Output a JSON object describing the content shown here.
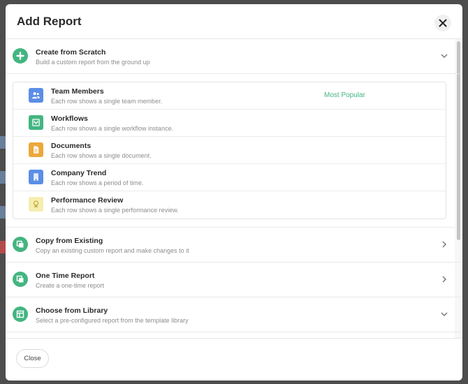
{
  "modal": {
    "title": "Add Report",
    "close_label": "Close"
  },
  "options": {
    "scratch": {
      "title": "Create from Scratch",
      "subtitle": "Build a custom report from the ground up"
    },
    "copy": {
      "title": "Copy from Existing",
      "subtitle": "Copy an existing custom report and make changes to it"
    },
    "one_time": {
      "title": "One Time Report",
      "subtitle": "Create a one-time report"
    },
    "library": {
      "title": "Choose from Library",
      "subtitle": "Select a pre-configured report from the template library"
    }
  },
  "scratch_items": [
    {
      "title": "Team Members",
      "desc": "Each row shows a single team member.",
      "icon": "team-members-icon",
      "color": "#5b8ee6"
    },
    {
      "title": "Workflows",
      "desc": "Each row shows a single workflow instance.",
      "icon": "workflow-icon",
      "color": "#43b581"
    },
    {
      "title": "Documents",
      "desc": "Each row shows a single document.",
      "icon": "document-icon",
      "color": "#eba83c"
    },
    {
      "title": "Company Trend",
      "desc": "Each row shows a period of time.",
      "icon": "building-icon",
      "color": "#5b8ee6"
    },
    {
      "title": "Performance Review",
      "desc": "Each row shows a single performance review.",
      "icon": "award-icon",
      "color": "#f5eeb0"
    }
  ],
  "badge": "Most Popular",
  "colors": {
    "accent": "#43b581"
  }
}
